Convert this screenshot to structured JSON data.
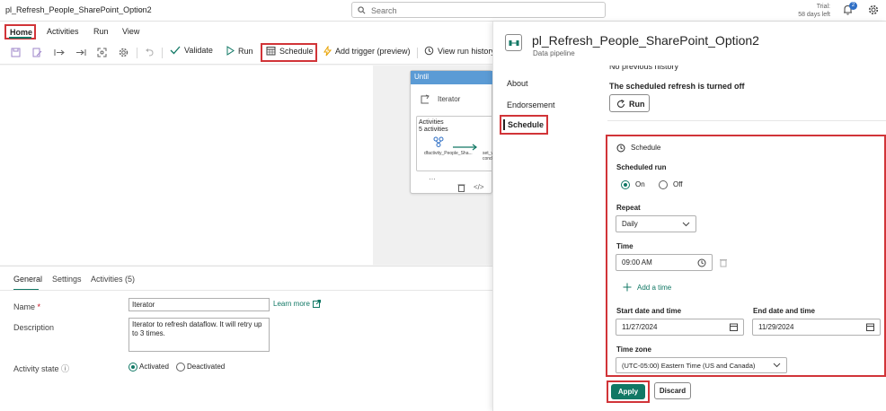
{
  "app": {
    "title": "pl_Refresh_People_SharePoint_Option2",
    "search_placeholder": "Search",
    "trial_line1": "Trial:",
    "trial_line2": "58 days left",
    "notifications_count": "2",
    "accent_color": "#117865",
    "highlight_color": "#d13438"
  },
  "menu": {
    "tabs": [
      "Home",
      "Activities",
      "Run",
      "View"
    ]
  },
  "toolbar": {
    "validate": "Validate",
    "run": "Run",
    "schedule": "Schedule",
    "add_trigger": "Add trigger (preview)",
    "view_run_history": "View run history"
  },
  "canvas": {
    "until_label": "Until",
    "iterator_label": "Iterator",
    "activities_title": "Activities",
    "activities_count": "5 activities",
    "activity1_name": "dfactivity_People_Sha...",
    "activity2_name": "set_v... cond..."
  },
  "properties": {
    "tabs": [
      "General",
      "Settings",
      "Activities (5)"
    ],
    "name_label": "Name",
    "name_required": "*",
    "name_value": "Iterator",
    "learn_more": "Learn more",
    "description_label": "Description",
    "description_value": "Iterator to refresh dataflow. It will retry up to 3 times.",
    "activity_state_label": "Activity state",
    "activated": "Activated",
    "deactivated": "Deactivated"
  },
  "panel": {
    "title": "pl_Refresh_People_SharePoint_Option2",
    "subtitle": "Data pipeline",
    "nav": [
      "About",
      "Endorsement",
      "Schedule"
    ],
    "history_text": "No previous history",
    "refresh_status": "The scheduled refresh is turned off",
    "run_button": "Run",
    "schedule_heading": "Schedule",
    "scheduled_run_label": "Scheduled run",
    "on_label": "On",
    "off_label": "Off",
    "repeat_label": "Repeat",
    "repeat_value": "Daily",
    "time_label": "Time",
    "time_value": "09:00 AM",
    "add_time": "Add a time",
    "start_label": "Start date and time",
    "start_value": "11/27/2024",
    "end_label": "End date and time",
    "end_value": "11/29/2024",
    "timezone_label": "Time zone",
    "timezone_value": "(UTC-05:00) Eastern Time (US and Canada)",
    "apply": "Apply",
    "discard": "Discard"
  }
}
